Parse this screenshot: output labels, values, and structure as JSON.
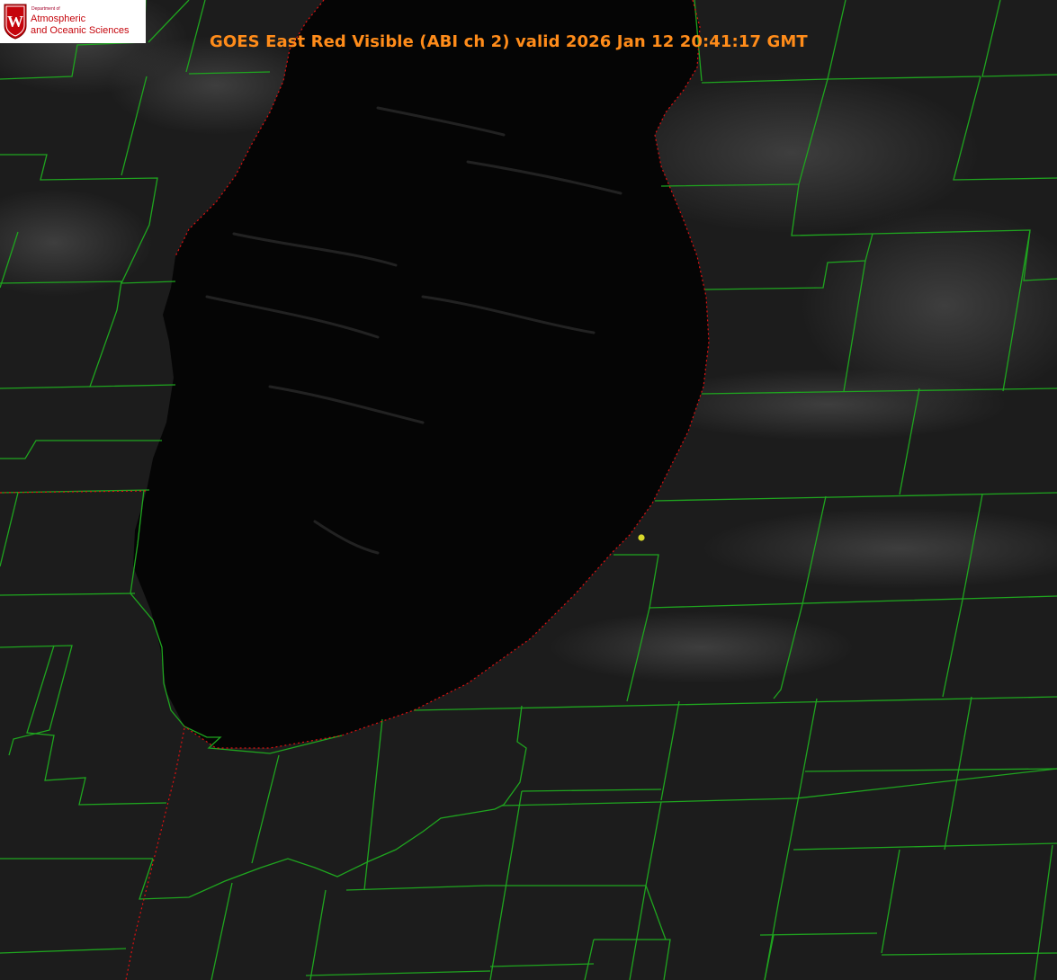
{
  "title": "GOES East Red Visible (ABI ch 2) valid 2026 Jan 12 20:41:17 GMT",
  "logo": {
    "department_text": "Department of",
    "line1": "Atmospheric",
    "line2": "and Oceanic Sciences",
    "crest_letter": "W"
  },
  "colors": {
    "background": "#000000",
    "land": "#1c1c1c",
    "lake": "#050505",
    "county_lines": "#1fa51f",
    "state_line": "#e01010",
    "title": "#ff8c1a",
    "marker": "#d8d82a",
    "logo_red": "#c5050c"
  },
  "map": {
    "features": [
      "lake-michigan",
      "county-boundaries",
      "state-boundary",
      "site-marker"
    ]
  }
}
